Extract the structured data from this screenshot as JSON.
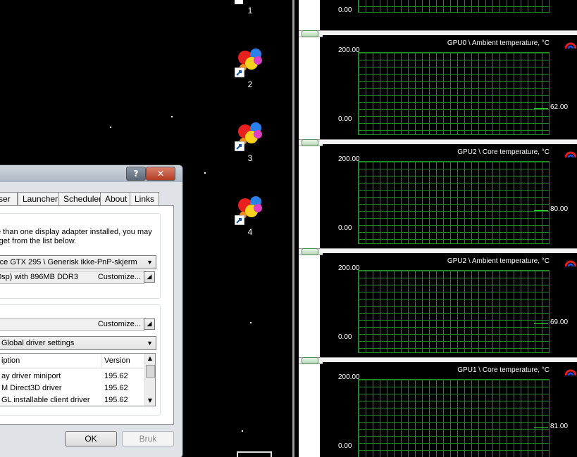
{
  "desktop": {
    "icons": [
      {
        "label": "1"
      },
      {
        "label": "2"
      },
      {
        "label": "3"
      },
      {
        "label": "4"
      }
    ]
  },
  "dialog": {
    "help_glyph": "?",
    "close_glyph": "✕",
    "tabs": [
      "ser",
      "Launcher",
      "Scheduler",
      "About",
      "Links"
    ],
    "info_line1": "e than one display adapter installed, you may",
    "info_line2": "rget from the list below.",
    "adapter_select": "rce GTX 295 \\ Generisk ikke-PnP-skjerm",
    "adapter_info": "0sp) with 896MB DDR3",
    "customize1": "Customize...",
    "customize2": "Customize...",
    "driver_select": "Global driver settings",
    "list": {
      "col1": "iption",
      "col2": "Version",
      "rows": [
        {
          "desc": "ay driver miniport",
          "ver": "195.62"
        },
        {
          "desc": "M Direct3D driver",
          "ver": "195.62"
        },
        {
          "desc": "GL installable client driver",
          "ver": "195.62"
        }
      ]
    },
    "ok_label": "OK",
    "apply_label": "Bruk"
  },
  "monitor": {
    "top_partial": {
      "ymin": "0.00"
    },
    "graphs": [
      {
        "title": "GPU0 \\ Ambient temperature, °C",
        "ymax": "200.00",
        "ymin": "0.00",
        "value": "62.00",
        "current": 62
      },
      {
        "title": "GPU2 \\ Core temperature, °C",
        "ymax": "200.00",
        "ymin": "0.00",
        "value": "80.00",
        "current": 80
      },
      {
        "title": "GPU2 \\ Ambient temperature, °C",
        "ymax": "200.00",
        "ymin": "0.00",
        "value": "69.00",
        "current": 69
      },
      {
        "title": "GPU1 \\ Core temperature, °C",
        "ymax": "200.00",
        "ymin": "0.00",
        "value": "81.00",
        "current": 81
      }
    ]
  }
}
